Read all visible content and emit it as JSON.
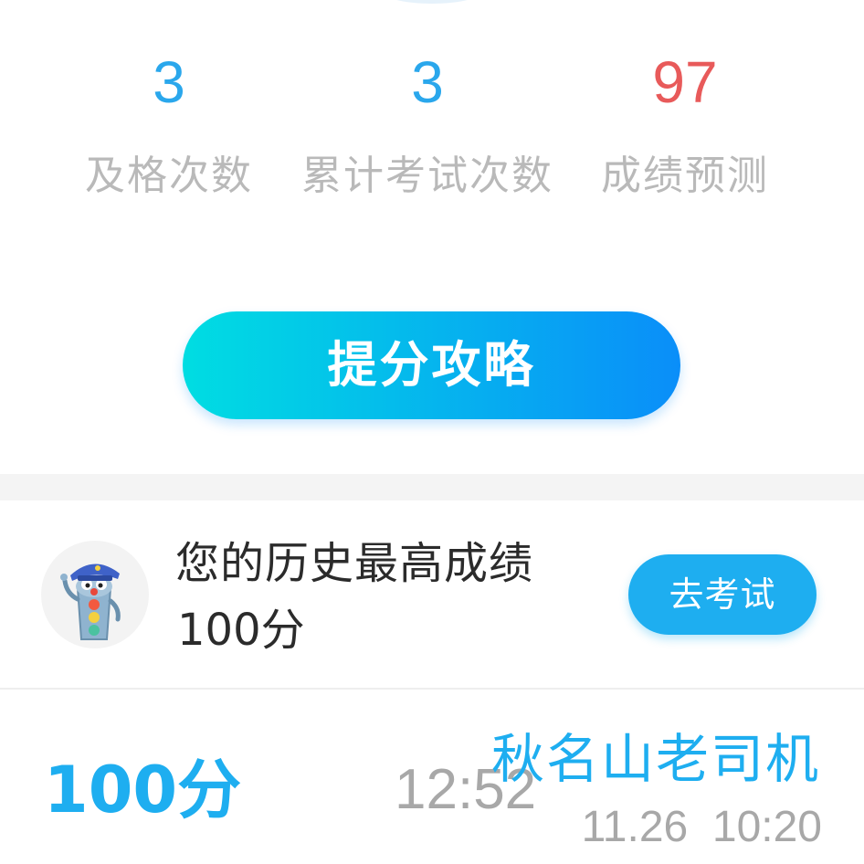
{
  "stats": [
    {
      "value": "3",
      "label": "及格次数",
      "color": "#2aa7ec"
    },
    {
      "value": "3",
      "label": "累计考试次数",
      "color": "#2aa7ec"
    },
    {
      "value": "97",
      "label": "成绩预测",
      "color": "#e85a5a"
    }
  ],
  "boost_button": {
    "label": "提分攻略"
  },
  "best_record": {
    "title": "您的历史最高成绩",
    "score": "100分",
    "exam_button_label": "去考试",
    "avatar_icon": "traffic-light-mascot-icon"
  },
  "history": [
    {
      "score": "100分",
      "duration": "12:52",
      "name": "秋名山老司机",
      "time": "11.26  10:20"
    }
  ],
  "colors": {
    "accent": "#1eaef0",
    "gradient_start": "#00dde2",
    "gradient_end": "#0a8ef9",
    "muted_text": "#b9b9b9",
    "danger": "#e85a5a"
  }
}
